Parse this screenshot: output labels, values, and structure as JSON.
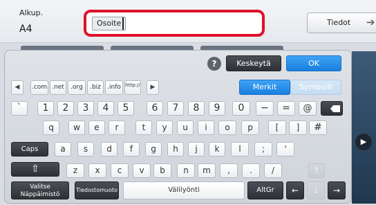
{
  "top": {
    "original_label": "Alkup.",
    "original_value": "A4",
    "address_tab": "Osoite",
    "address_value": "",
    "details_label": "Tiedot"
  },
  "keyboard": {
    "cancel": "Keskeytä",
    "ok": "OK",
    "chars": "Merkit",
    "symbols": "Symbolit",
    "domains": [
      ".com",
      ".net",
      ".org",
      ".biz",
      ".info",
      "http://"
    ],
    "row1": [
      "`",
      "1",
      "2",
      "3",
      "4",
      "5",
      "6",
      "7",
      "8",
      "9",
      "0",
      "−",
      "=",
      "@"
    ],
    "row2": [
      "q",
      "w",
      "e",
      "r",
      "t",
      "y",
      "u",
      "i",
      "o",
      "p",
      "[",
      "]",
      "#"
    ],
    "caps": "Caps",
    "row3": [
      "a",
      "s",
      "d",
      "f",
      "g",
      "h",
      "j",
      "k",
      "l",
      ";",
      "'"
    ],
    "shift_glyph": "⇧",
    "row4": [
      "z",
      "x",
      "c",
      "v",
      "b",
      "n",
      "m",
      ",",
      ".",
      "/"
    ],
    "select_keyboard": "Valitse\nNäppäimistö",
    "file_format": "Tiedostomuoto",
    "space": "Välilyönti",
    "altgr": "AltGr"
  }
}
